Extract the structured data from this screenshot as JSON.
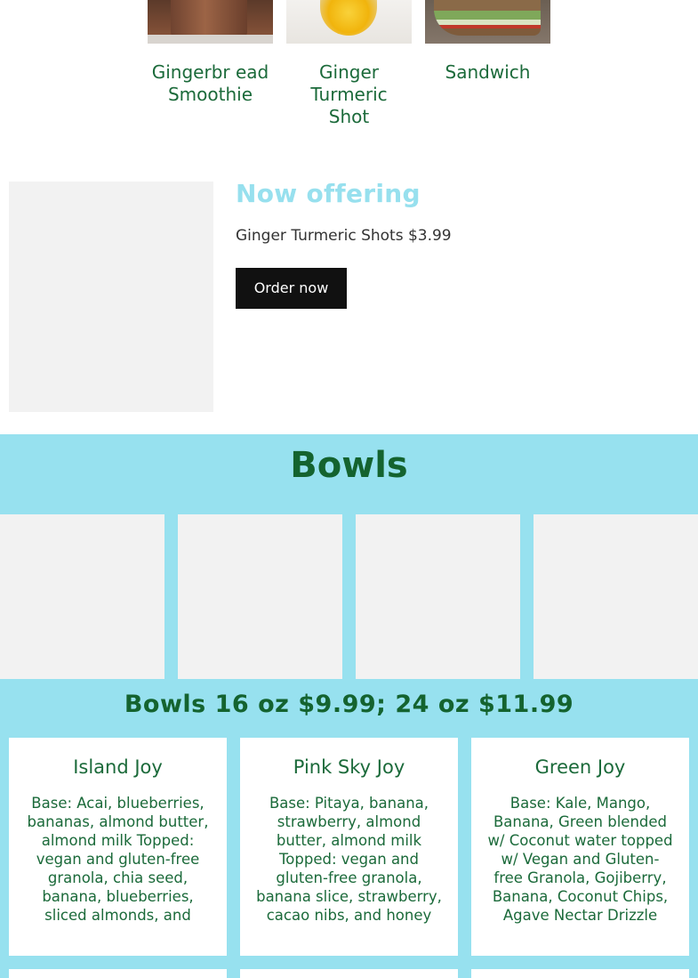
{
  "products": [
    {
      "name": "Gingerbr ead Smoothie",
      "image": "smoothie-photo"
    },
    {
      "name": "Ginger Turmeric Shot",
      "image": "shot-photo"
    },
    {
      "name": "Sandwich",
      "image": "sandwich-photo"
    }
  ],
  "offer": {
    "title": "Now offering",
    "text": "Ginger Turmeric Shots $3.99",
    "button": "Order now"
  },
  "bowls": {
    "title": "Bowls",
    "price": "Bowls 16 oz $9.99; 24 oz $11.99",
    "items": [
      {
        "name": "Island Joy",
        "description": "Base: Acai, blueberries, bananas, almond butter, almond milk Topped: vegan and gluten-free granola, chia seed, banana, blueberries, sliced almonds, and honey drizzle"
      },
      {
        "name": "Pink Sky Joy",
        "description": "Base: Pitaya, banana, strawberry, almond butter, almond milk Topped: vegan and gluten-free granola, banana slice, strawberry, cacao nibs, and honey drizzle"
      },
      {
        "name": "Green Joy",
        "description": "Base: Kale, Mango, Banana, Green blended w/ Coconut water topped w/ Vegan and Gluten-free Granola, Gojiberry, Banana, Coconut Chips, Agave Nectar Drizzle"
      }
    ]
  },
  "colors": {
    "brand_green": "#14632f",
    "accent_cyan": "#97e1ef",
    "button_black": "#111111"
  }
}
